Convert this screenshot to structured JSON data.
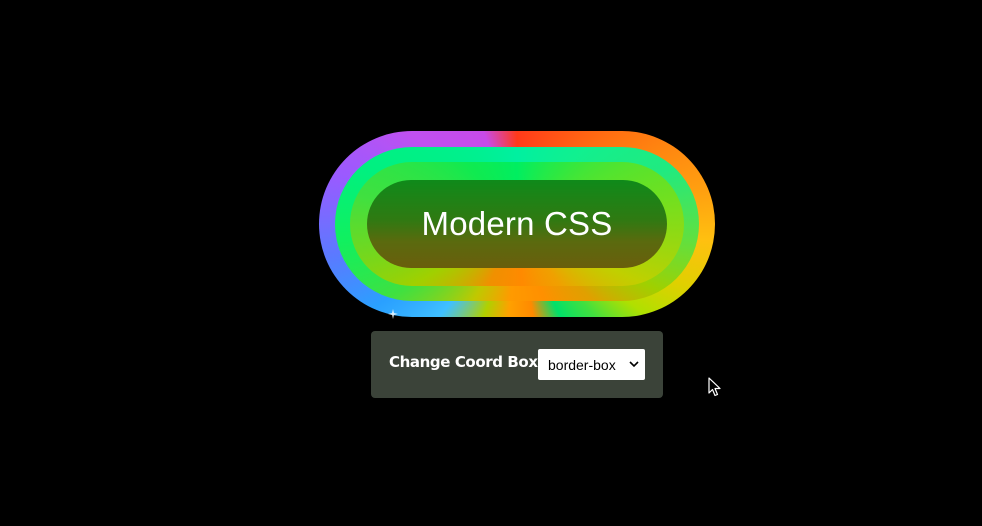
{
  "demo": {
    "pill_text": "Modern CSS",
    "colors": {
      "background": "#000000",
      "panel": "#3b4339",
      "inner_top": "#0f8a1a",
      "inner_bottom": "#6a5e0c"
    }
  },
  "controls": {
    "label": "Change Coord Box:",
    "select": {
      "value": "border-box",
      "icon": "chevron-down-icon"
    }
  },
  "pointer": {
    "icon": "mouse-cursor-icon"
  }
}
